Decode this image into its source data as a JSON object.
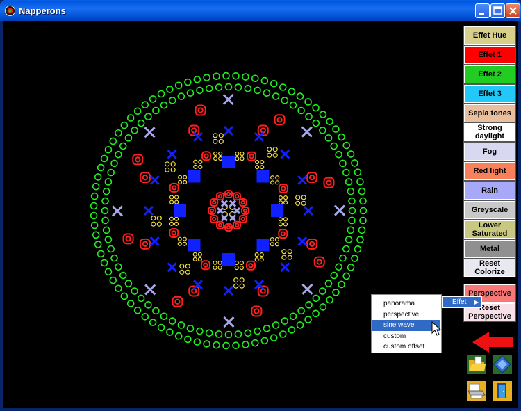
{
  "window": {
    "title": "Napperons"
  },
  "buttons": [
    {
      "label": "Effet Hue",
      "color": "#d8d08a"
    },
    {
      "label": "Effet 1",
      "color": "#ff0000"
    },
    {
      "label": "Effet 2",
      "color": "#22cc22"
    },
    {
      "label": "Effet 3",
      "color": "#22c8f8"
    },
    {
      "label": "Sepia tones",
      "color": "#e8c0a0"
    },
    {
      "label": "Strong\ndaylight",
      "color": "#ffffff"
    },
    {
      "label": "Fog",
      "color": "#d8d8f0"
    },
    {
      "label": "Red light",
      "color": "#f8805a"
    },
    {
      "label": "Rain",
      "color": "#a8a8f8"
    },
    {
      "label": "Greyscale",
      "color": "#c8c8c8"
    },
    {
      "label": "Lower\nSaturated",
      "color": "#c8c880"
    },
    {
      "label": "Metal",
      "color": "#909090"
    },
    {
      "label": "Reset\nColorize",
      "color": "#e8e8f0"
    },
    {
      "label": "Perspective",
      "color": "#f87878"
    },
    {
      "label": "Reset\nPerspective",
      "color": "#f8e0e8"
    }
  ],
  "context_menu": {
    "parent_item": "Effet",
    "items": [
      "panorama",
      "perspective",
      "sine wave",
      "custom",
      "custom offset"
    ],
    "selected": "sine wave"
  },
  "icons": {
    "back": "red-arrow-left-icon",
    "open": "open-folder-icon",
    "save": "save-disk-icon",
    "print": "printer-icon",
    "exit": "exit-door-icon"
  },
  "colors": {
    "ring": "#22ee22",
    "red": "#ff2020",
    "blue": "#1020ff",
    "yellow": "#f8e040",
    "lavender": "#a8a8e8"
  }
}
